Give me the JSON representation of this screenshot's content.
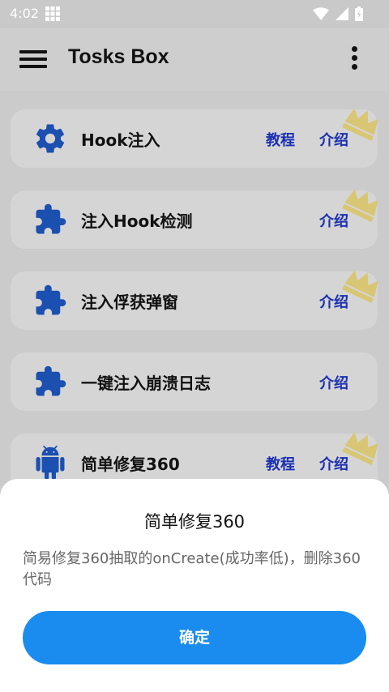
{
  "status_bar": {
    "time": "4:02"
  },
  "app_bar": {
    "title": "Tosks Box"
  },
  "cards": [
    {
      "label": "Hook注入",
      "icon": "gear-icon",
      "tutorial": "教程",
      "intro": "介绍",
      "crown": true
    },
    {
      "label": "注入Hook检测",
      "icon": "puzzle-icon",
      "intro": "介绍",
      "crown": true
    },
    {
      "label": "注入俘获弹窗",
      "icon": "puzzle-icon",
      "intro": "介绍",
      "crown": true
    },
    {
      "label": "一键注入崩溃日志",
      "icon": "puzzle-icon",
      "intro": "介绍",
      "crown": false
    },
    {
      "label": "简单修复360",
      "icon": "android-icon",
      "tutorial": "教程",
      "intro": "介绍",
      "crown": true
    }
  ],
  "dialog": {
    "title": "简单修复360",
    "message": "简易修复360抽取的onCreate(成功率低)，删除360代码",
    "confirm": "确定"
  },
  "colors": {
    "accent": "#1a8cf0",
    "link": "#1a2fb0",
    "icon": "#1b4fb0",
    "crown": "#d9c56a"
  }
}
